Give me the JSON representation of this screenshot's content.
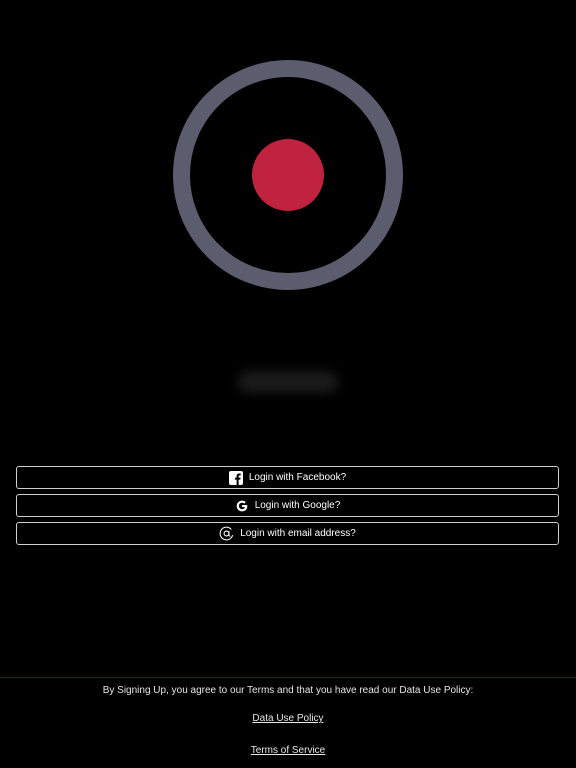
{
  "login": {
    "facebook_label": "Login with Facebook?",
    "google_label": "Login with Google?",
    "email_label": "Login with email address?"
  },
  "footer": {
    "agreement": "By Signing Up, you agree to our Terms and that you have read our Data Use Policy:",
    "data_use_policy": "Data Use Policy",
    "terms_of_service": "Terms of Service"
  },
  "colors": {
    "background": "#000000",
    "logo_ring": "#5b5c6d",
    "logo_dot": "#c0233f",
    "button_border": "#cfcfcf",
    "footer_divider": "#5a0d18"
  },
  "icons": {
    "facebook": "facebook-icon",
    "google": "google-icon",
    "email": "at-sign-icon"
  }
}
